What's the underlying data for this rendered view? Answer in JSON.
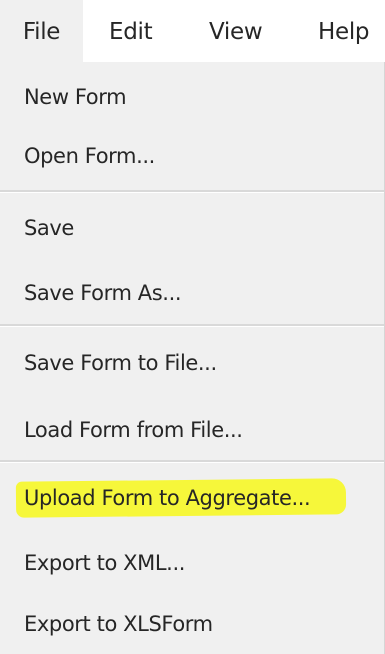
{
  "menubar": {
    "file": "File",
    "edit": "Edit",
    "view": "View",
    "help": "Help"
  },
  "file_menu": {
    "new_form": "New Form",
    "open_form": "Open Form...",
    "save": "Save",
    "save_form_as": "Save Form As...",
    "save_form_to_file": "Save Form to File...",
    "load_form_from_file": "Load Form from File...",
    "upload_form_to_aggregate": "Upload Form to Aggregate...",
    "export_to_xml": "Export to XML...",
    "export_to_xlsform": "Export to XLSForm"
  },
  "colors": {
    "menu_background": "#f0f0f0",
    "text": "#262626",
    "separator": "#d9d9d9",
    "highlighter": "#f6f73a"
  }
}
